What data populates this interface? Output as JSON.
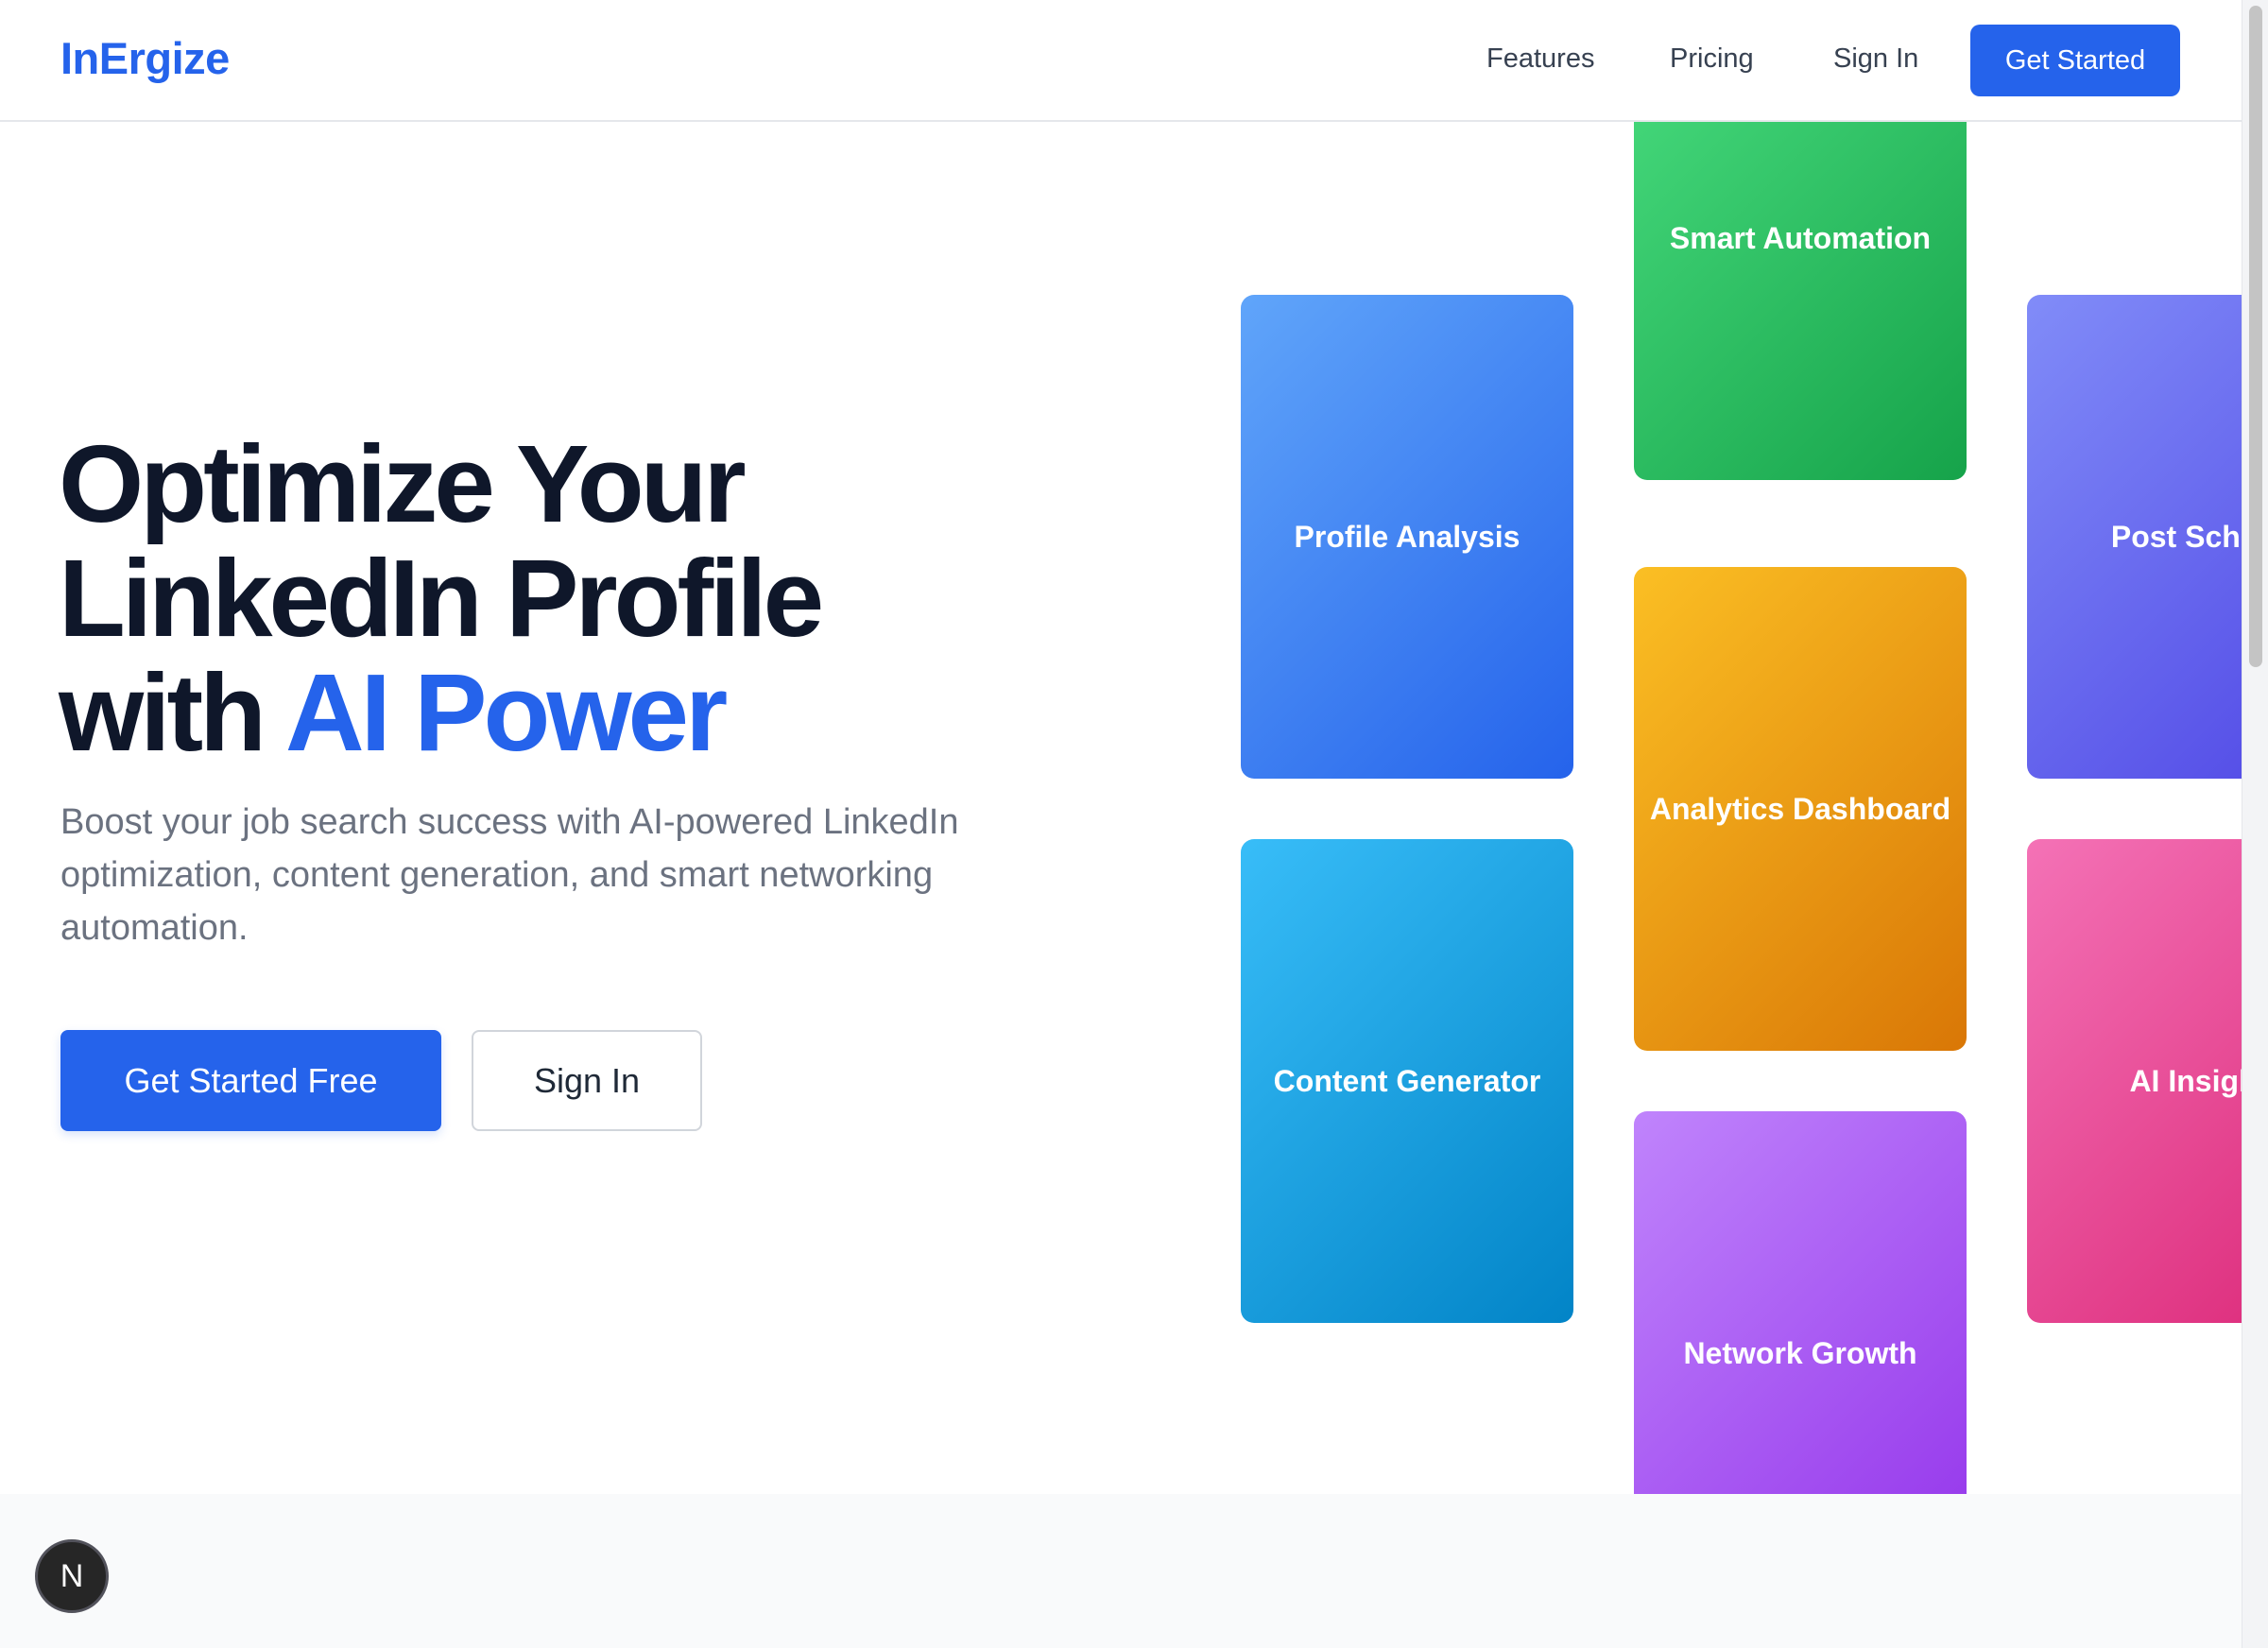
{
  "header": {
    "brand": "InErgize",
    "nav": {
      "features": "Features",
      "pricing": "Pricing",
      "sign_in": "Sign In"
    },
    "cta": "Get Started"
  },
  "hero": {
    "title_line1": "Optimize Your",
    "title_line2": "LinkedIn Profile",
    "title_line3_prefix": "with ",
    "title_line3_accent": "AI Power",
    "subtitle": "Boost your job search success with AI-powered LinkedIn optimization, content generation, and smart networking automation.",
    "primary_button": "Get Started Free",
    "secondary_button": "Sign In"
  },
  "feature_cards": {
    "profile_analysis": "Profile Analysis",
    "content_generator": "Content Generator",
    "smart_automation": "Smart Automation",
    "analytics_dashboard": "Analytics Dashboard",
    "network_growth": "Network Growth",
    "post_scheduler": "Post Sched",
    "ai_insights": "AI Insigh"
  },
  "devtools_badge": "N",
  "colors": {
    "accent": "#2563eb",
    "heading": "#0f172a",
    "muted_text": "#6b7280"
  }
}
